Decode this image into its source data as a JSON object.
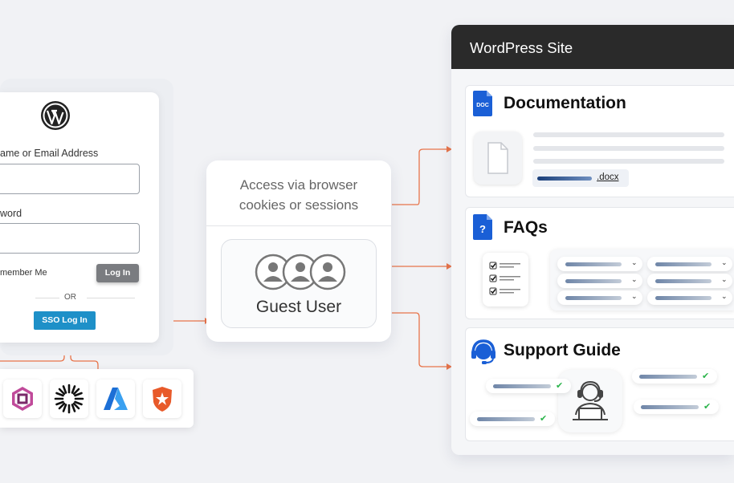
{
  "login": {
    "username_label": "ame or Email Address",
    "password_label": "word",
    "remember_label": "member Me",
    "login_button": "Log In",
    "or_text": "OR",
    "sso_button": "SSO Log In"
  },
  "access": {
    "caption_line1": "Access via browser",
    "caption_line2": "cookies or sessions",
    "guest_label": "Guest User"
  },
  "site": {
    "title": "WordPress Site",
    "sections": {
      "documentation": {
        "title": "Documentation",
        "doc_badge": "DOC",
        "file_ext": ".docx"
      },
      "faqs": {
        "title": "FAQs",
        "badge": "?"
      },
      "support": {
        "title": "Support Guide"
      }
    }
  },
  "colors": {
    "accent_orange": "#e8744a",
    "sso_blue": "#1e90c8",
    "doc_blue": "#1a5fd6",
    "header_dark": "#2a2a2a",
    "check_green": "#2bb44b"
  },
  "icons": [
    "wordpress-logo-icon",
    "cognito-icon",
    "okta-icon",
    "azure-icon",
    "auth0-icon"
  ]
}
